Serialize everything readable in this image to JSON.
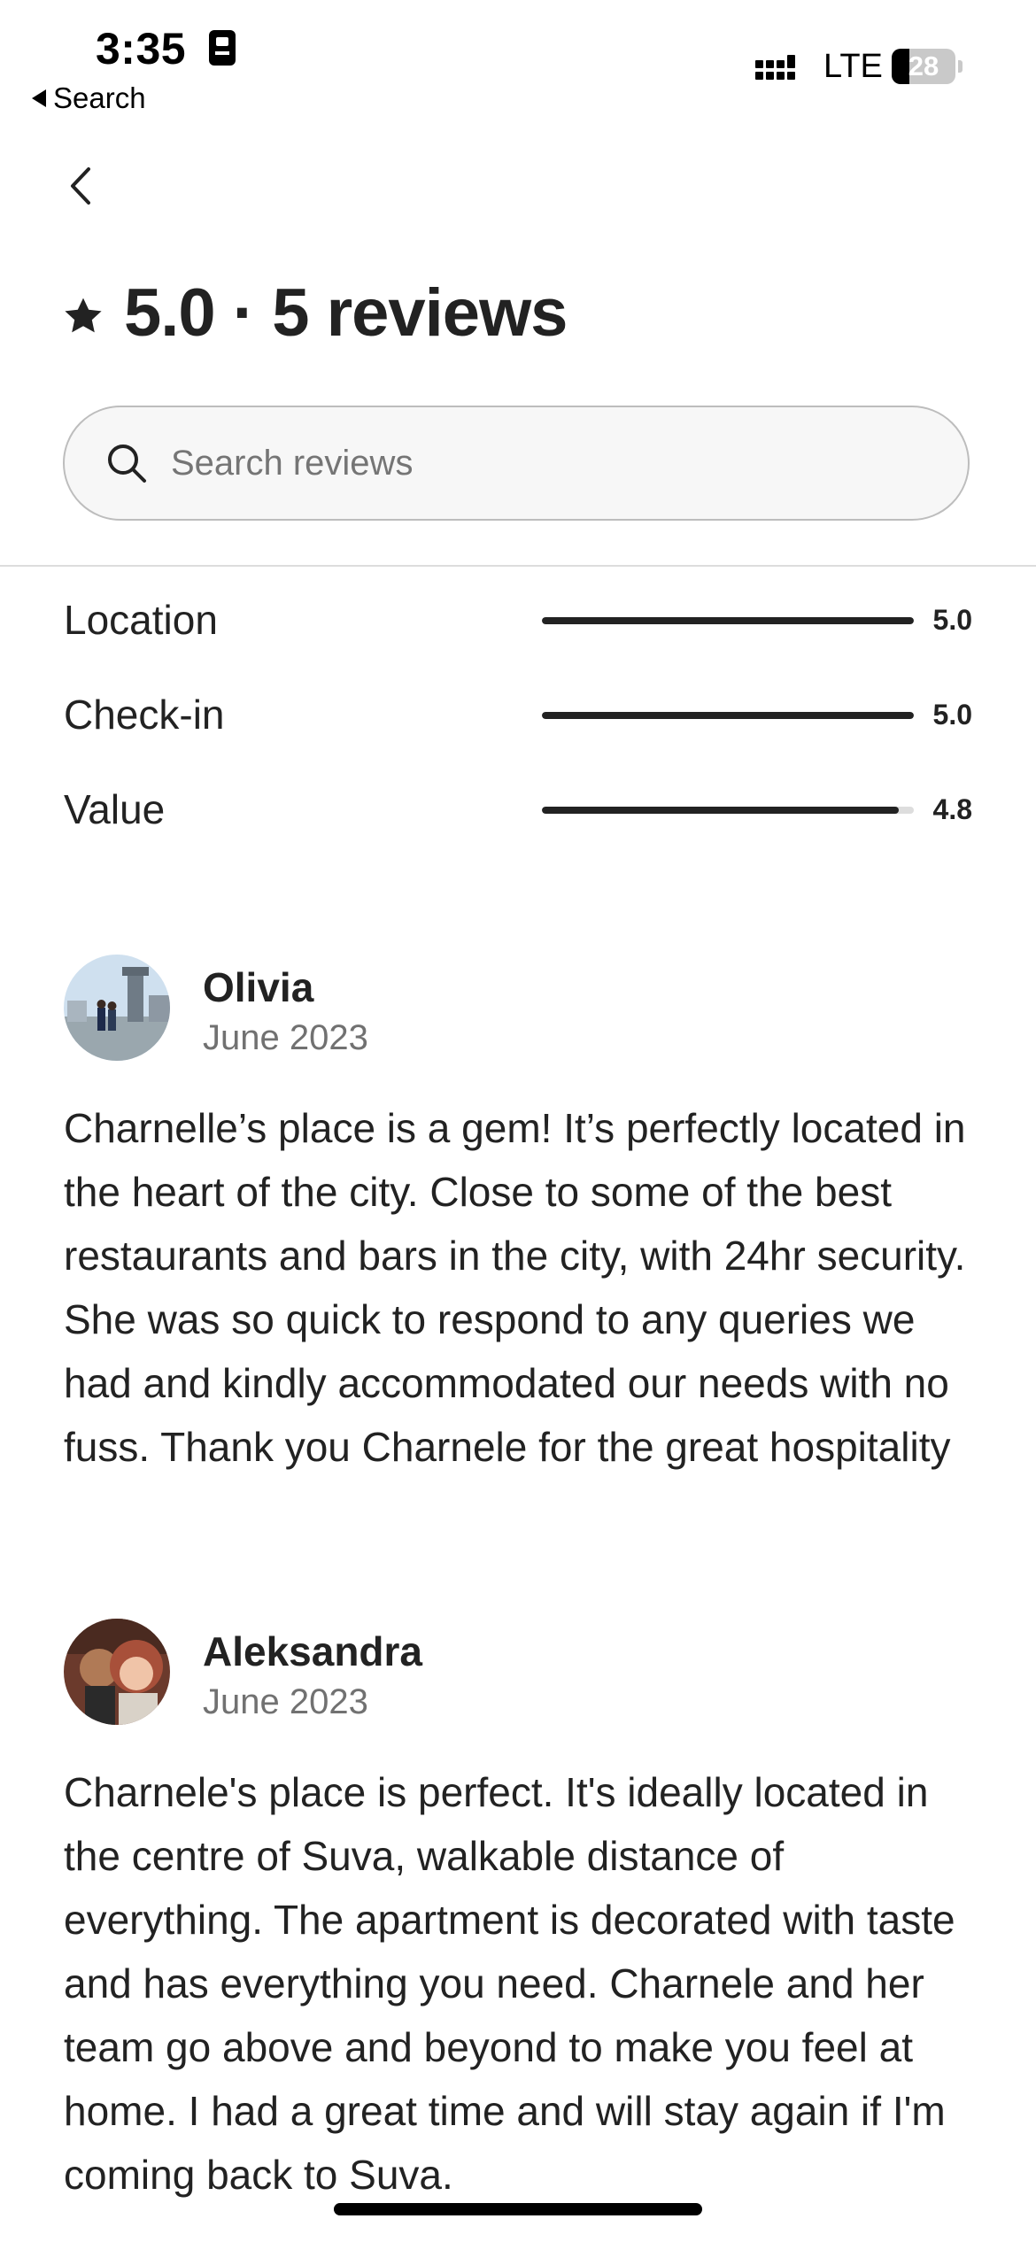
{
  "status_bar": {
    "time": "3:35",
    "back_label": "Search",
    "network": "LTE",
    "battery": "28",
    "battery_level": 0.28
  },
  "header": {
    "rating_summary": "5.0 · 5 reviews"
  },
  "search": {
    "placeholder": "Search reviews",
    "value": ""
  },
  "categories": [
    {
      "label": "Location",
      "score": "5.0",
      "fraction": 1.0
    },
    {
      "label": "Check-in",
      "score": "5.0",
      "fraction": 1.0
    },
    {
      "label": "Value",
      "score": "4.8",
      "fraction": 0.96
    }
  ],
  "reviews": [
    {
      "name": "Olivia",
      "date": "June 2023",
      "text": "Charnelle’s place is a gem! It’s perfectly located in the heart of the city. Close to some of the best restaurants and bars in the city, with 24hr security. She was so quick to respond to any queries we had and kindly accommodated our needs with no fuss. Thank you Charnele for the great hospitality"
    },
    {
      "name": "Aleksandra",
      "date": "June 2023",
      "text": "Charnele's place is perfect. It's ideally located in the centre of Suva, walkable distance of everything. The apartment is decorated with taste and has everything you need. Charnele and her team go above and beyond to make you feel at home. I had a great time and will stay again if I'm coming back to Suva."
    }
  ],
  "colors": {
    "text": "#222222",
    "muted": "#717171",
    "divider": "#dddddd"
  }
}
